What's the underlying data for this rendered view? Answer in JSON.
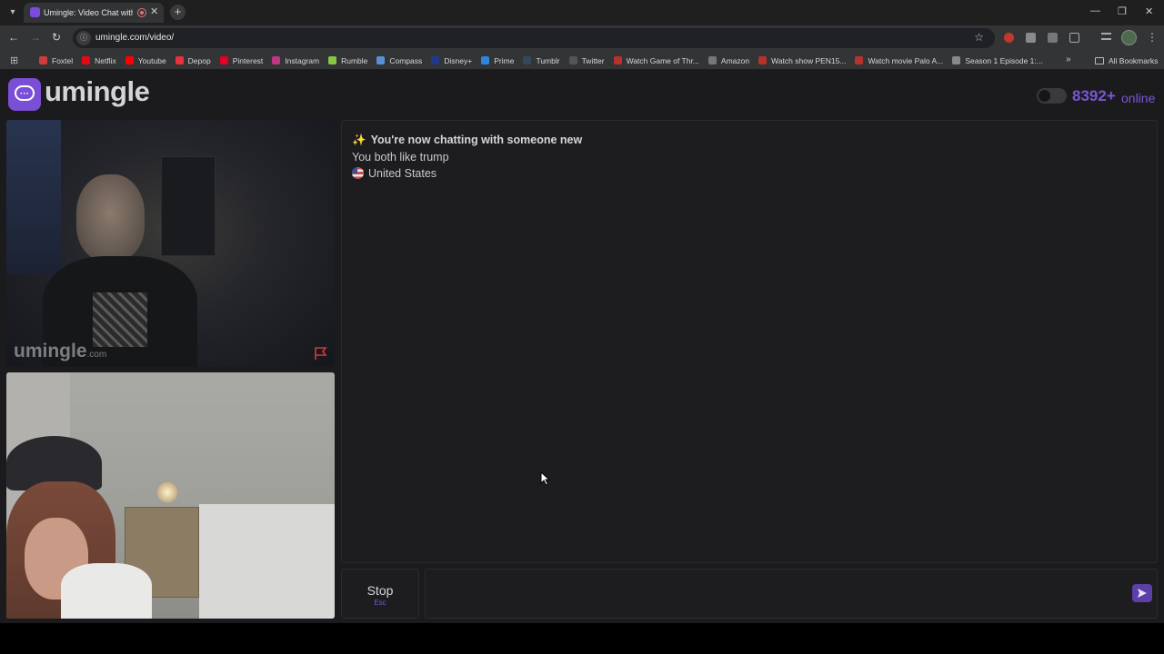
{
  "browser": {
    "tab": {
      "title": "Umingle: Video Chat with S"
    },
    "url": "umingle.com/video/",
    "bookmarks": [
      {
        "label": "Foxtel",
        "color": "#d23b3b"
      },
      {
        "label": "Netflix",
        "color": "#e50914"
      },
      {
        "label": "Youtube",
        "color": "#ff0000"
      },
      {
        "label": "Depop",
        "color": "#e8323a"
      },
      {
        "label": "Pinterest",
        "color": "#e60023"
      },
      {
        "label": "Instagram",
        "color": "#c13584"
      },
      {
        "label": "Rumble",
        "color": "#85c742"
      },
      {
        "label": "Compass",
        "color": "#5a8fd8"
      },
      {
        "label": "Disney+",
        "color": "#1f3a8a"
      },
      {
        "label": "Prime",
        "color": "#2b88d9"
      },
      {
        "label": "Tumblr",
        "color": "#36465d"
      },
      {
        "label": "Twitter",
        "color": "#555555"
      },
      {
        "label": "Watch Game of Thr...",
        "color": "#b8322b"
      },
      {
        "label": "Amazon",
        "color": "#777777"
      },
      {
        "label": "Watch show PEN15...",
        "color": "#b8322b"
      },
      {
        "label": "Watch movie Palo A...",
        "color": "#b8322b"
      },
      {
        "label": "Season 1 Episode 1:...",
        "color": "#888888"
      }
    ],
    "all_bookmarks": "All Bookmarks"
  },
  "app": {
    "logo_text": "umingle",
    "online_count": "8392+",
    "online_label": "online",
    "accent_color": "#7b55d6",
    "watermark": {
      "main": "umingle",
      "suffix": ".com"
    }
  },
  "chat": {
    "headline": "You're now chatting with someone new",
    "interest": "You both like trump",
    "country": "United States"
  },
  "controls": {
    "stop_label": "Stop",
    "stop_shortcut": "Esc",
    "message_value": ""
  }
}
